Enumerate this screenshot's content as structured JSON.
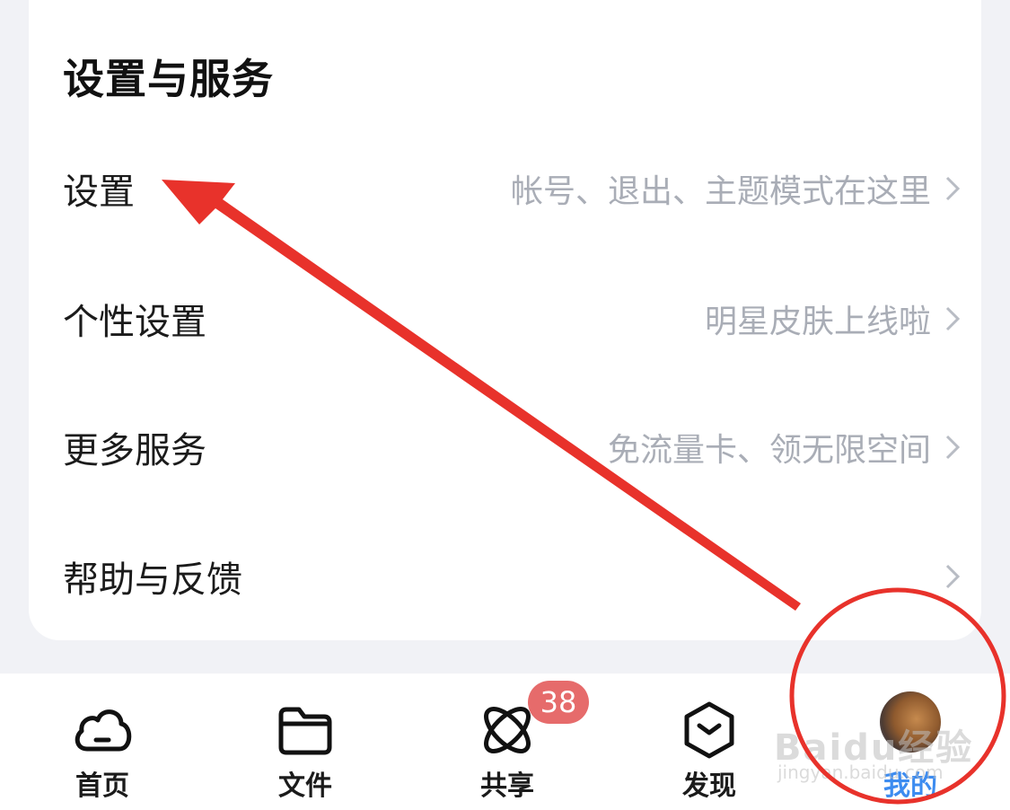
{
  "section": {
    "title": "设置与服务"
  },
  "rows": [
    {
      "label": "设置",
      "hint": "帐号、退出、主题模式在这里"
    },
    {
      "label": "个性设置",
      "hint": "明星皮肤上线啦"
    },
    {
      "label": "更多服务",
      "hint": "免流量卡、领无限空间"
    },
    {
      "label": "帮助与反馈",
      "hint": ""
    }
  ],
  "tabs": [
    {
      "label": "首页",
      "icon": "cloud-icon"
    },
    {
      "label": "文件",
      "icon": "folder-icon"
    },
    {
      "label": "共享",
      "icon": "share-orbit-icon",
      "badge": "38"
    },
    {
      "label": "发现",
      "icon": "discover-cube-icon"
    },
    {
      "label": "我的",
      "icon": "avatar",
      "active": true
    }
  ],
  "watermark": {
    "brand": "Baidu经验",
    "url": "jingyan.baidu.com"
  },
  "colors": {
    "accent": "#3d8cf0",
    "badge": "#e66b6b",
    "annotation": "#e8322b"
  }
}
